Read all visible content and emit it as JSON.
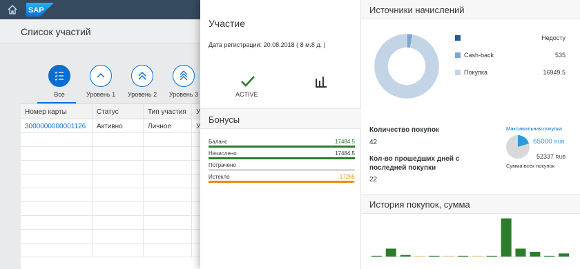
{
  "shell": {
    "logo": "SAP"
  },
  "page": {
    "title": "Список участий"
  },
  "levels": [
    {
      "label": "Все",
      "icon": "list-icon",
      "active": true
    },
    {
      "label": "Уровень 1",
      "icon": "chevron-up-icon",
      "active": false
    },
    {
      "label": "Уровень 2",
      "icon": "double-chevron-up-icon",
      "active": false
    },
    {
      "label": "Уровень 3",
      "icon": "double-chevron-up-icon",
      "active": false
    }
  ],
  "table": {
    "headers": [
      "Номер карты",
      "Статус",
      "Тип участия",
      "Ур"
    ],
    "rows": [
      [
        "3000000000001126",
        "Активно",
        "Личное",
        "Ур"
      ]
    ]
  },
  "participation": {
    "title": "Участие",
    "registration": "Дата регистрации: 20.08.2018 ( 8 м.8 д. )",
    "status": "ACTIVE"
  },
  "bonuses": {
    "title": "Бонусы",
    "rows": [
      {
        "label": "Баланс",
        "value": "17484.5",
        "fraction": 1.0,
        "color": "#2b7d2b"
      },
      {
        "label": "Начислено",
        "value": "17484.5",
        "fraction": 1.0,
        "color": "#2b7d2b"
      },
      {
        "label": "Потрачено",
        "value": "",
        "fraction": 0.0,
        "color": "#2b7d2b"
      },
      {
        "label": "Истекло",
        "value": "17285",
        "fraction": 0.99,
        "color": "#e78c07"
      }
    ]
  },
  "sources": {
    "title": "Источники начислений",
    "legend": [
      {
        "name": "",
        "value": "Недосту",
        "color": "#1f5a9a"
      },
      {
        "name": "Cash-back",
        "value": "535",
        "color": "#7fa6cc"
      },
      {
        "name": "Покупка",
        "value": "16949.5",
        "color": "#c3d4e6"
      }
    ],
    "colors": {
      "accent": "#0a6ed1"
    }
  },
  "kpi": {
    "purchases_label": "Количество покупок",
    "purchases_value": "42",
    "days_label": "Кол-во прошедших дней с последней покупки",
    "days_value": "22",
    "max_label": "Максимальная покупка",
    "max_value": "65000",
    "max_unit": "RUB",
    "sum_value": "52337",
    "sum_unit": "RUB",
    "sum_label": "Сумма всех покупок"
  },
  "history": {
    "title": "История покупок, сумма"
  },
  "chart_data": [
    {
      "type": "pie",
      "categories": [
        "Недосту",
        "Cash-back",
        "Покупка"
      ],
      "values": [
        0,
        535,
        16949.5
      ]
    },
    {
      "type": "bar",
      "values": [
        0.5,
        5,
        1,
        0.5,
        0.5,
        0.5,
        0.5,
        0.5,
        0.5,
        24,
        5,
        3,
        0.5,
        2
      ],
      "ylim": [
        0,
        26
      ]
    }
  ]
}
